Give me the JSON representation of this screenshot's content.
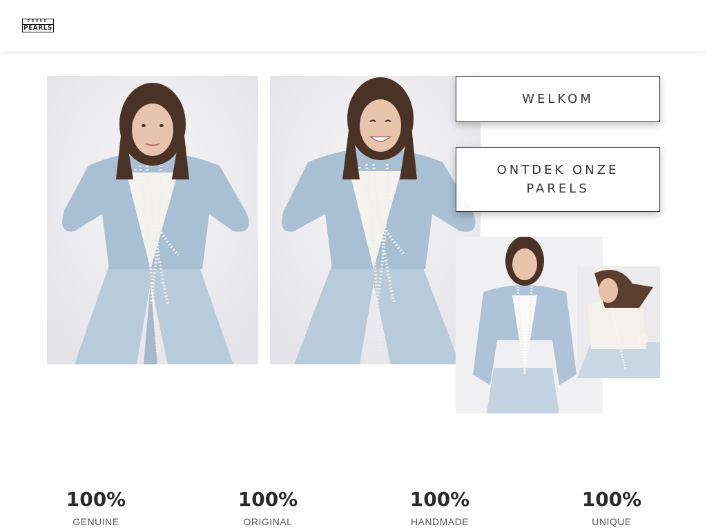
{
  "header": {
    "logo_top": "PROUD",
    "logo_bottom": "PEARLS"
  },
  "hero": {
    "welkom_label": "WELKOM",
    "ontdek_label": "ONTDEK ONZE PARELS"
  },
  "stats": [
    {
      "value": "100%",
      "label": "GENUINE"
    },
    {
      "value": "100%",
      "label": "ORIGINAL"
    },
    {
      "value": "100%",
      "label": "HANDMADE"
    },
    {
      "value": "100%",
      "label": "UNIQUE"
    }
  ],
  "colors": {
    "background": "#ffffff",
    "denim": "#b9cbdc",
    "pearl": "#f3efe4",
    "hair": "#4a3326",
    "text": "#2a2a2a"
  }
}
